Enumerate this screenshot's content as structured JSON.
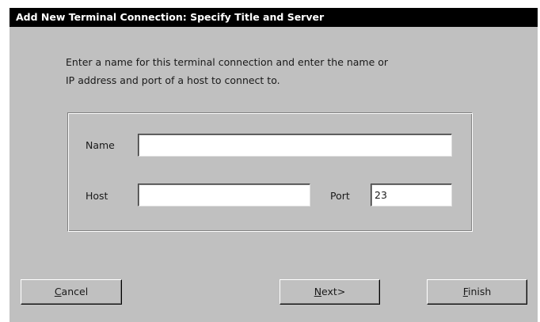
{
  "window": {
    "title": "Add New Terminal Connection: Specify Title and Server"
  },
  "intro": {
    "line1": "Enter a name for this terminal connection and enter the name or",
    "line2": "IP address and port of a host to connect to."
  },
  "form": {
    "name_label": "Name",
    "name_value": "",
    "host_label": "Host",
    "host_value": "",
    "port_label": "Port",
    "port_value": "23"
  },
  "buttons": {
    "cancel": {
      "mnemonic": "C",
      "rest": "ancel"
    },
    "next": {
      "mnemonic": "N",
      "rest": "ext>"
    },
    "finish": {
      "mnemonic": "F",
      "rest": "inish"
    }
  }
}
